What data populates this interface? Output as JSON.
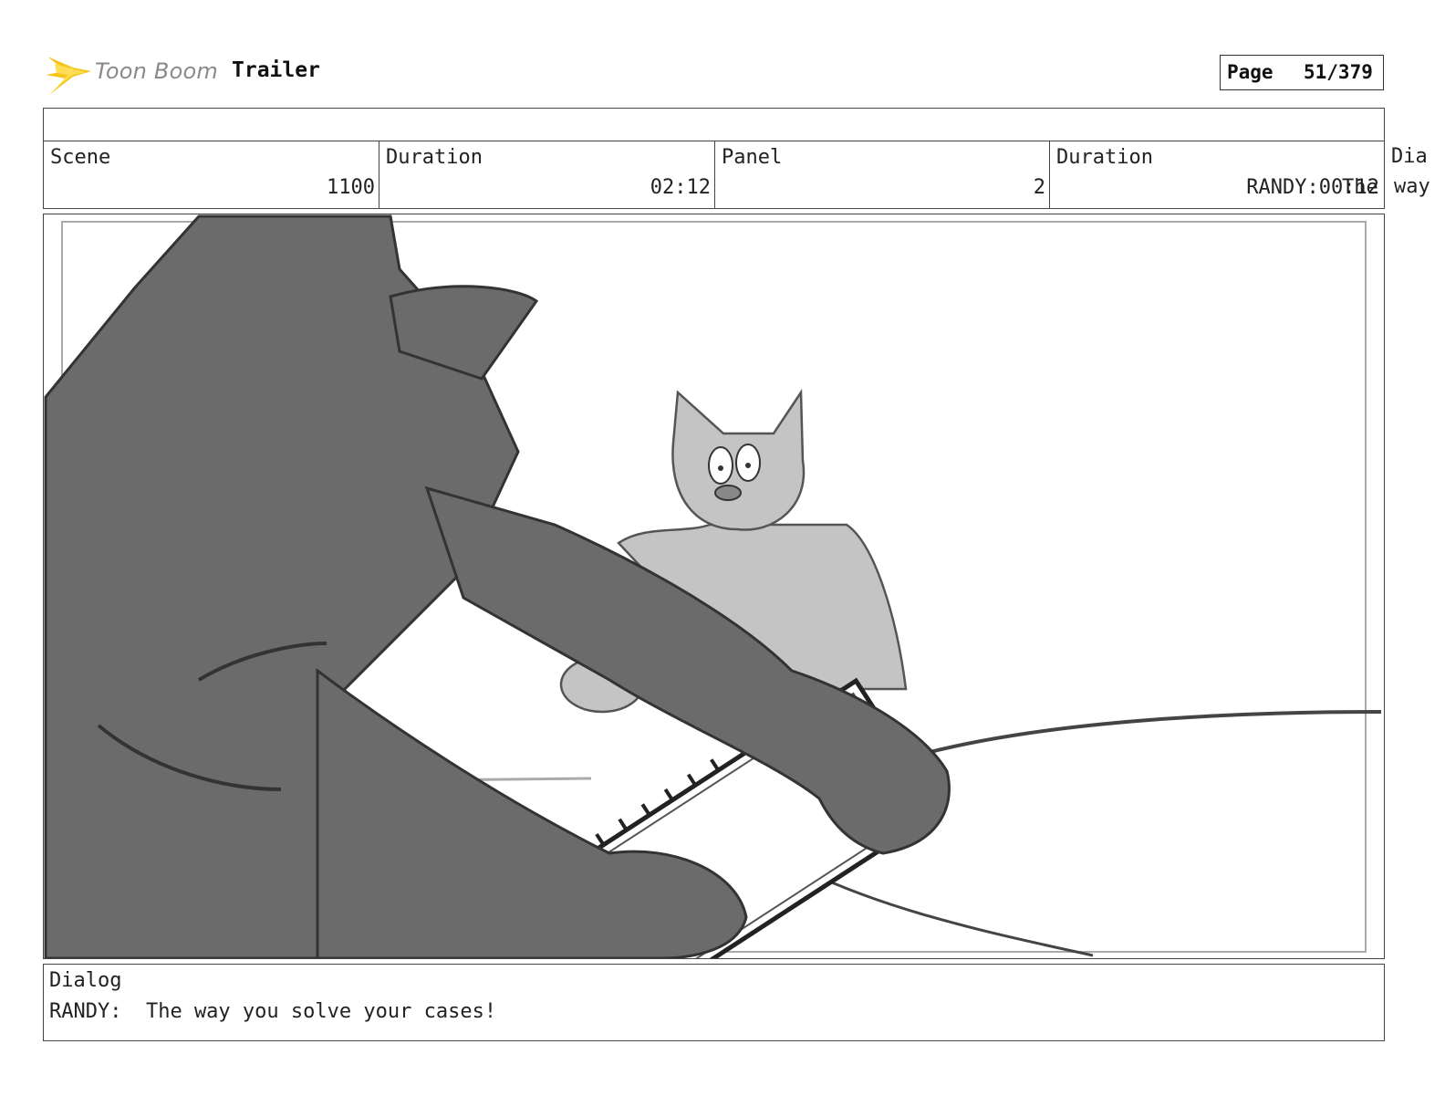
{
  "header": {
    "logo_text": "Toon Boom",
    "project_title": "Trailer",
    "page_label": "Page",
    "page_number": "51/379"
  },
  "info": {
    "scene_label": "Scene",
    "scene_value": "1100",
    "scene_duration_label": "Duration",
    "scene_duration_value": "02:12",
    "panel_label": "Panel",
    "panel_value": "2",
    "panel_duration_label": "Duration",
    "panel_duration_value": "RANDY:00:12",
    "overlap_text": "The",
    "clipped_label": "Dia",
    "clipped_value": "way"
  },
  "dialog": {
    "label": "Dialog",
    "text": "RANDY:  The way you solve your cases!"
  },
  "colors": {
    "logo_accent": "#f5c518",
    "border": "#444444",
    "sketch_dark": "#6b6b6b",
    "sketch_light": "#c4c4c4"
  }
}
